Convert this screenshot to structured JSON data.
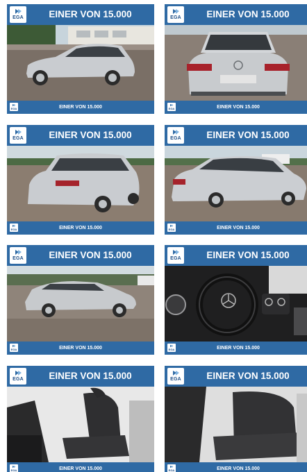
{
  "colors": {
    "brand_blue": "#2f6aa4",
    "logo_blue": "#1e4f87",
    "text": "#ffffff"
  },
  "tiles": [
    {
      "headline": "EINER VON 15.000",
      "footer": "EINER VON 15.000",
      "logo": "EGA",
      "photo": "side-view-exterior"
    },
    {
      "headline": "EINER VON 15.000",
      "footer": "EINER VON 15.000",
      "logo": "EGA",
      "photo": "rear-view-exterior"
    },
    {
      "headline": "EINER VON 15.000",
      "footer": "EINER VON 15.000",
      "logo": "EGA",
      "photo": "rear-three-quarter-exterior"
    },
    {
      "headline": "EINER VON 15.000",
      "footer": "EINER VON 15.000",
      "logo": "EGA",
      "photo": "side-rear-exterior"
    },
    {
      "headline": "EINER VON 15.000",
      "footer": "EINER VON 15.000",
      "logo": "EGA",
      "photo": "front-three-quarter-exterior"
    },
    {
      "headline": "EINER VON 15.000",
      "footer": "EINER VON 15.000",
      "logo": "EGA",
      "photo": "steering-wheel-cockpit"
    },
    {
      "headline": "EINER VON 15.000",
      "footer": "EINER VON 15.000",
      "logo": "EGA",
      "photo": "driver-seat-interior"
    },
    {
      "headline": "EINER VON 15.000",
      "footer": "EINER VON 15.000",
      "logo": "EGA",
      "photo": "rear-seats-interior"
    }
  ]
}
